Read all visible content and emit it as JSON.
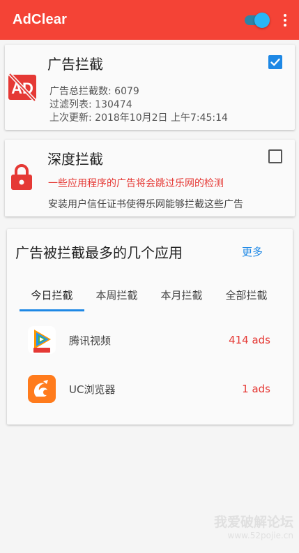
{
  "appbar": {
    "title": "AdClear",
    "toggle_on": true,
    "color": "#f44336"
  },
  "ad_block": {
    "title": "广告拦截",
    "checked": true,
    "icon": "ad-block-icon",
    "stats": [
      "广告总拦截数: 6079",
      "过滤列表: 130474",
      "上次更新: 2018年10月2日  上午7:45:14"
    ]
  },
  "deep_block": {
    "title": "深度拦截",
    "checked": false,
    "icon": "lock-icon",
    "warning": "一些应用程序的广告将会跳过乐网的检测",
    "description": "安装用户信任证书使得乐网能够拦截这些广告"
  },
  "top_apps": {
    "title": "广告被拦截最多的几个应用",
    "more_label": "更多",
    "tabs": [
      "今日拦截",
      "本周拦截",
      "本月拦截",
      "全部拦截"
    ],
    "active_tab": 0,
    "apps": [
      {
        "name": "腾讯视频",
        "count": "414 ads",
        "icon": "tencent-video-icon"
      },
      {
        "name": "UC浏览器",
        "count": "1 ads",
        "icon": "uc-browser-icon"
      }
    ]
  },
  "watermark": {
    "line1": "我爱破解论坛",
    "line2": "www.52pojie.cn"
  },
  "colors": {
    "accent": "#1e88e5",
    "alert": "#e53935",
    "primary": "#f44336"
  }
}
